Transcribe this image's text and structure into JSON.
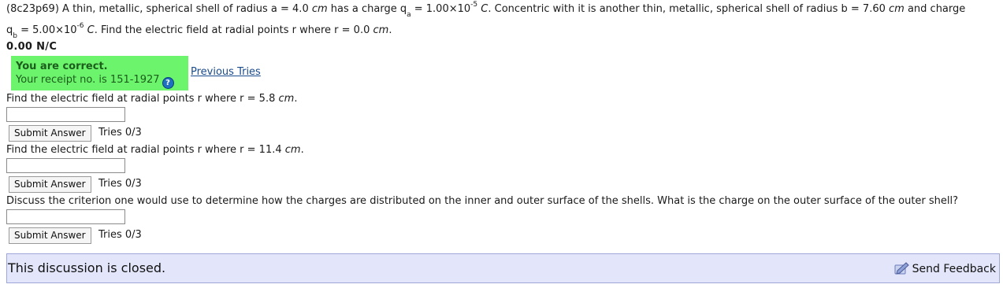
{
  "problem": {
    "id": "(8c23p69)",
    "line1_a": " A thin, metallic, spherical shell of radius a = 4.0 ",
    "unit_cm": "cm",
    "line1_b": " has a charge q",
    "sub_a": "a",
    "line1_c": " = 1.00×10",
    "exp_a": "-5",
    "unit_C": "C",
    "line1_d": ". Concentric with it is another thin, metallic, spherical shell of radius b = 7.60 ",
    "line1_e": " and charge",
    "line2_q": "q",
    "sub_b": "b",
    "line2_a": " = 5.00×10",
    "exp_b": "-6",
    "line2_b": ". Find the electric field at radial points r where r = 0.0 ",
    "line2_end": "."
  },
  "answer1": {
    "value": "0.00 N/C",
    "status_title": "You are correct.",
    "receipt": "Your receipt no. is 151-1927",
    "help_glyph": "?",
    "previous_tries": "Previous Tries"
  },
  "questions": [
    {
      "text_a": "Find the electric field at radial points r where r = 5.8 ",
      "unit": "cm",
      "text_b": ".",
      "input_value": "",
      "submit_label": "Submit Answer",
      "tries": "Tries 0/3"
    },
    {
      "text_a": "Find the electric field at radial points r where r = 11.4 ",
      "unit": "cm",
      "text_b": ".",
      "input_value": "",
      "submit_label": "Submit Answer",
      "tries": "Tries 0/3"
    },
    {
      "text_a": "Discuss the criterion one would use to determine how the charges are distributed on the inner and outer surface of the shells. What is the charge on the outer surface of the outer shell?",
      "unit": "",
      "text_b": "",
      "input_value": "",
      "submit_label": "Submit Answer",
      "tries": "Tries 0/3"
    }
  ],
  "footer": {
    "closed_text": "This discussion is closed.",
    "feedback_label": "Send Feedback",
    "feedback_icon": "pencil-note-icon"
  },
  "colors": {
    "correct_bg": "#6cf46c",
    "correct_text": "#1c5c1c",
    "link": "#1a4b8c",
    "closed_bg": "#e3e6fb",
    "closed_border": "#9fa6d8"
  }
}
